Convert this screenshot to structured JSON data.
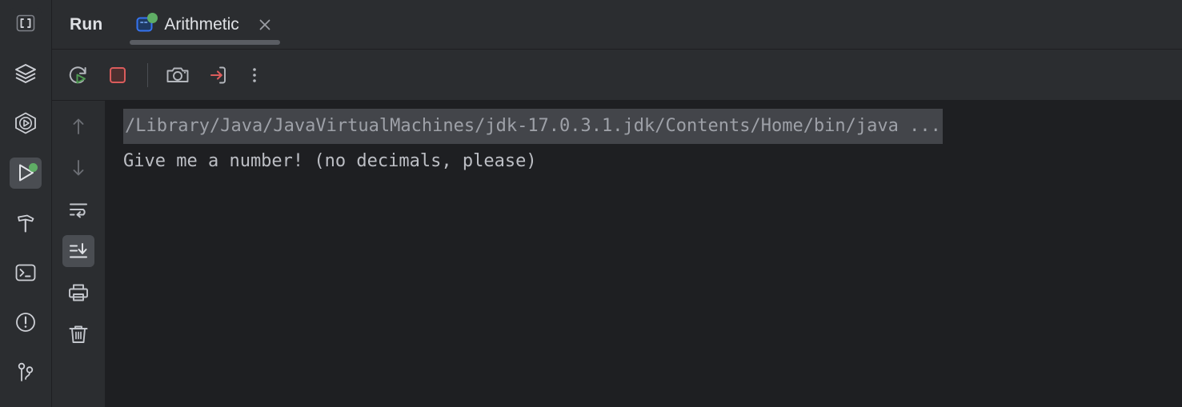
{
  "window": {
    "theme": "dark",
    "background": "#1e1f22",
    "panel_background": "#2b2d30",
    "accent_green": "#5fad65",
    "accent_red": "#db5c5c",
    "accent_blue": "#3574f0",
    "text_color": "#dfe1e5"
  },
  "activity_bar": {
    "items": [
      {
        "name": "project-brackets-icon",
        "label": "Project",
        "selected": false,
        "boxed": true,
        "badge": false
      },
      {
        "name": "layers-icon",
        "label": "Services",
        "selected": false,
        "boxed": false,
        "badge": false
      },
      {
        "name": "hexagon-play-icon",
        "label": "Run Configurations",
        "selected": false,
        "boxed": false,
        "badge": false
      },
      {
        "name": "play-icon",
        "label": "Run",
        "selected": true,
        "boxed": false,
        "badge": true
      },
      {
        "name": "hammer-icon",
        "label": "Build",
        "selected": false,
        "boxed": false,
        "badge": false
      },
      {
        "name": "terminal-icon",
        "label": "Terminal",
        "selected": false,
        "boxed": false,
        "badge": false
      },
      {
        "name": "problems-icon",
        "label": "Problems",
        "selected": false,
        "boxed": false,
        "badge": false
      },
      {
        "name": "git-branch-icon",
        "label": "Version Control",
        "selected": false,
        "boxed": false,
        "badge": false
      }
    ]
  },
  "header": {
    "tool_window_title": "Run",
    "tabs": [
      {
        "label": "Arithmetic",
        "icon": "run-configuration-icon",
        "running": true,
        "active": true,
        "close_label": "×"
      }
    ]
  },
  "toolbar": {
    "buttons": [
      {
        "name": "rerun-button",
        "label": "Rerun 'Arithmetic'",
        "icon": "rerun-icon"
      },
      {
        "name": "stop-button",
        "label": "Stop 'Arithmetic'",
        "icon": "stop-icon"
      },
      {
        "name": "separator",
        "label": "",
        "icon": "separator"
      },
      {
        "name": "dump-threads-button",
        "label": "Get Thread Dump",
        "icon": "camera-icon"
      },
      {
        "name": "export-button",
        "label": "Export",
        "icon": "export-arrow-icon"
      },
      {
        "name": "more-options-button",
        "label": "More Options",
        "icon": "vertical-dots-icon"
      }
    ]
  },
  "console_gutter": {
    "buttons": [
      {
        "name": "previous-occurrence-button",
        "label": "Up the Stack Trace",
        "icon": "arrow-up-icon",
        "enabled": false,
        "selected": false
      },
      {
        "name": "next-occurrence-button",
        "label": "Down the Stack Trace",
        "icon": "arrow-down-icon",
        "enabled": false,
        "selected": false
      },
      {
        "name": "soft-wrap-button",
        "label": "Soft-Wrap",
        "icon": "soft-wrap-icon",
        "enabled": true,
        "selected": false
      },
      {
        "name": "scroll-to-end-button",
        "label": "Scroll to the End",
        "icon": "scroll-to-end-icon",
        "enabled": true,
        "selected": true
      },
      {
        "name": "print-button",
        "label": "Print",
        "icon": "printer-icon",
        "enabled": true,
        "selected": false
      },
      {
        "name": "clear-all-button",
        "label": "Clear All",
        "icon": "trash-icon",
        "enabled": true,
        "selected": false
      }
    ]
  },
  "console": {
    "lines": [
      {
        "text": "/Library/Java/JavaVirtualMachines/jdk-17.0.3.1.jdk/Contents/Home/bin/java ...",
        "type": "command",
        "highlighted": true
      },
      {
        "text": "Give me a number! (no decimals, please)",
        "type": "stdout",
        "highlighted": false
      }
    ]
  }
}
